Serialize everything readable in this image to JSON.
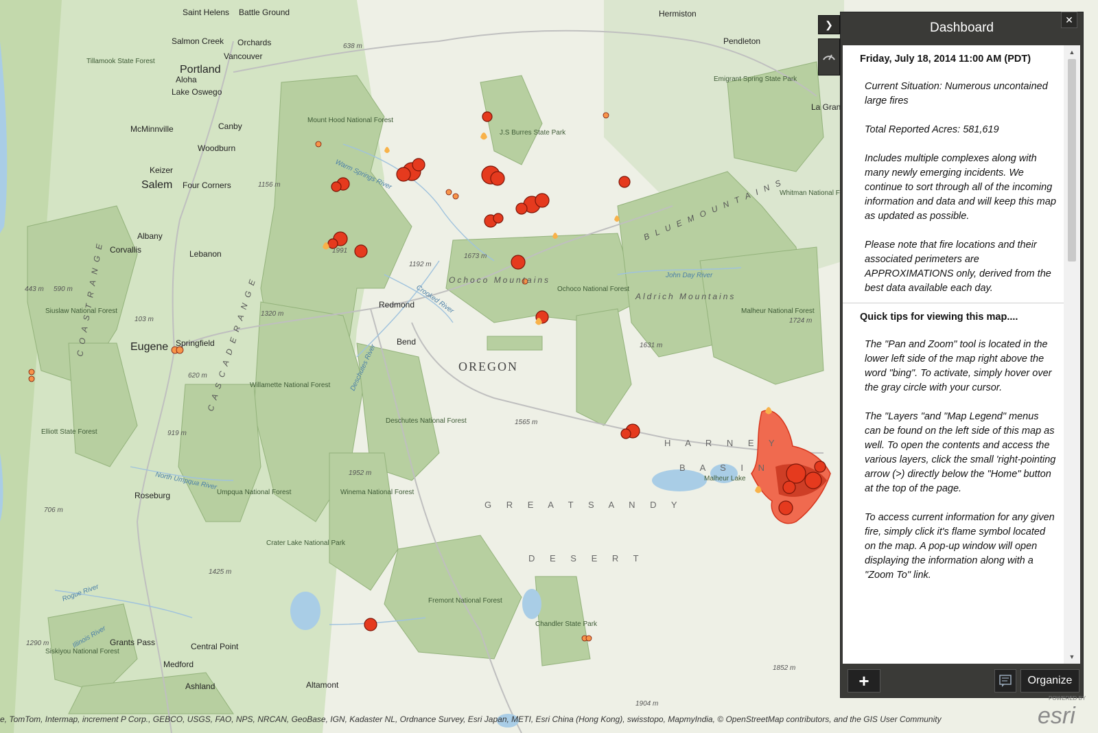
{
  "dashboard": {
    "title": "Dashboard",
    "close_icon": "close-icon",
    "datetime": "Friday, July 18, 2014  11:00 AM (PDT)",
    "paragraphs": [
      "Current Situation: Numerous uncontained large fires",
      "Total Reported Acres: 581,619",
      "Includes multiple complexes along with many newly emerging incidents. We continue to sort through all of the incoming information and data and will keep this map as updated as possible.",
      "Please note that fire locations and their associated perimeters are APPROXIMATIONS only, derived from the best data available each day."
    ],
    "tips_heading": "Quick tips for viewing this map....",
    "tips": [
      "The \"Pan and Zoom\" tool is located in the lower left side of the map right above the word \"bing\".  To activate, simply hover over the gray circle with your cursor.",
      "The \"Layers \"and \"Map Legend\" menus can be found on the left side of this map as well.  To open the contents and access the various layers,  click the small 'right-pointing arrow (>) directly below the \"Home\" button at the top of the page.",
      "To access current information for any given fire, simply click it's flame symbol located on the map.  A pop-up window will open displaying the information along with a \"Zoom To\" link."
    ],
    "add_label": "+",
    "organize_label": "Organize"
  },
  "map": {
    "cities": [
      {
        "name": "Saint Helens"
      },
      {
        "name": "Battle Ground"
      },
      {
        "name": "Salmon Creek"
      },
      {
        "name": "Orchards"
      },
      {
        "name": "Vancouver"
      },
      {
        "name": "Portland"
      },
      {
        "name": "Aloha"
      },
      {
        "name": "Lake Oswego"
      },
      {
        "name": "McMinnville"
      },
      {
        "name": "Canby"
      },
      {
        "name": "Woodburn"
      },
      {
        "name": "Keizer"
      },
      {
        "name": "Salem"
      },
      {
        "name": "Four Corners"
      },
      {
        "name": "Albany"
      },
      {
        "name": "Corvallis"
      },
      {
        "name": "Lebanon"
      },
      {
        "name": "Eugene"
      },
      {
        "name": "Springfield"
      },
      {
        "name": "Redmond"
      },
      {
        "name": "Bend"
      },
      {
        "name": "Roseburg"
      },
      {
        "name": "Grants Pass"
      },
      {
        "name": "Central Point"
      },
      {
        "name": "Medford"
      },
      {
        "name": "Ashland"
      },
      {
        "name": "Altamont"
      },
      {
        "name": "Hermiston"
      },
      {
        "name": "Pendleton"
      },
      {
        "name": "La Grande"
      }
    ],
    "state_label": "OREGON",
    "region_labels": [
      "H A R N E Y",
      "B A S I N",
      "G R E A T   S A N D Y",
      "D E S E R T"
    ],
    "mountain_labels": [
      "Ochoco Mountains",
      "Aldrich Mountains",
      "B L U E   M O U N T A I N S",
      "C A S C A D E   R A N G E",
      "C O A S T   R A N G E"
    ],
    "forest_labels": [
      "Tillamook State Forest",
      "Mount Hood National Forest",
      "J.S Burres State Park",
      "Siuslaw National Forest",
      "Willamette National Forest",
      "Ochoco National Forest",
      "Deschutes National Forest",
      "Malheur National Forest",
      "Whitman National Forest",
      "Umpqua National Forest",
      "Winema National Forest",
      "Crater Lake National Park",
      "Fremont National Forest",
      "Chandler State Park",
      "Elliott State Forest",
      "Emigrant Spring State Park",
      "Siskiyou National Forest"
    ],
    "river_labels": [
      "Warm Springs River",
      "Crooked River",
      "Deschutes River",
      "John Day River",
      "North Umpqua River",
      "Rogue River",
      "Illinois River"
    ],
    "elevations": [
      "638 m",
      "1156 m",
      "1991",
      "1192 m",
      "1673 m",
      "1320 m",
      "103 m",
      "443 m",
      "590 m",
      "620 m",
      "919 m",
      "706 m",
      "1425 m",
      "1290 m",
      "1565 m",
      "1952 m",
      "1631 m",
      "1724 m",
      "1852 m",
      "1904 m"
    ],
    "lake_label": "Malheur Lake",
    "attribution": "e, TomTom, Intermap, increment P Corp., GEBCO, USGS, FAO, NPS, NRCAN, GeoBase, IGN, Kadaster NL, Ordnance Survey, Esri Japan, METI, Esri China (Hong Kong), swisstopo, MapmyIndia, © OpenStreetMap contributors, and the GIS User Community",
    "esri_powered": "POWERED BY",
    "esri_word": "esri"
  },
  "colors": {
    "forest_green": "#b7cfa0",
    "forest_border": "#8fae78",
    "fire_red": "#e53a1e",
    "fire_orange": "#f7944a",
    "perimeter": "#f06a4f"
  }
}
